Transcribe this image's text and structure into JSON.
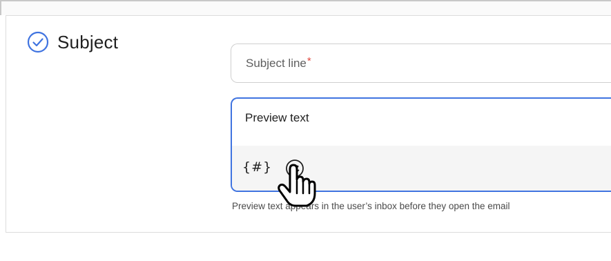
{
  "section": {
    "title": "Subject",
    "status_icon": "check-circle-icon",
    "accent_color": "#3f73e0"
  },
  "subject_line": {
    "placeholder": "Subject line",
    "required_marker": "*",
    "required_color": "#e0483e"
  },
  "preview_text": {
    "value": "Preview text",
    "toolbar": {
      "variable_button": "{#}",
      "emoji_icon": "smiley-icon"
    },
    "helper": "Preview text appears in the user’s inbox before they open the email"
  },
  "cursor": "hand-pointer-icon"
}
